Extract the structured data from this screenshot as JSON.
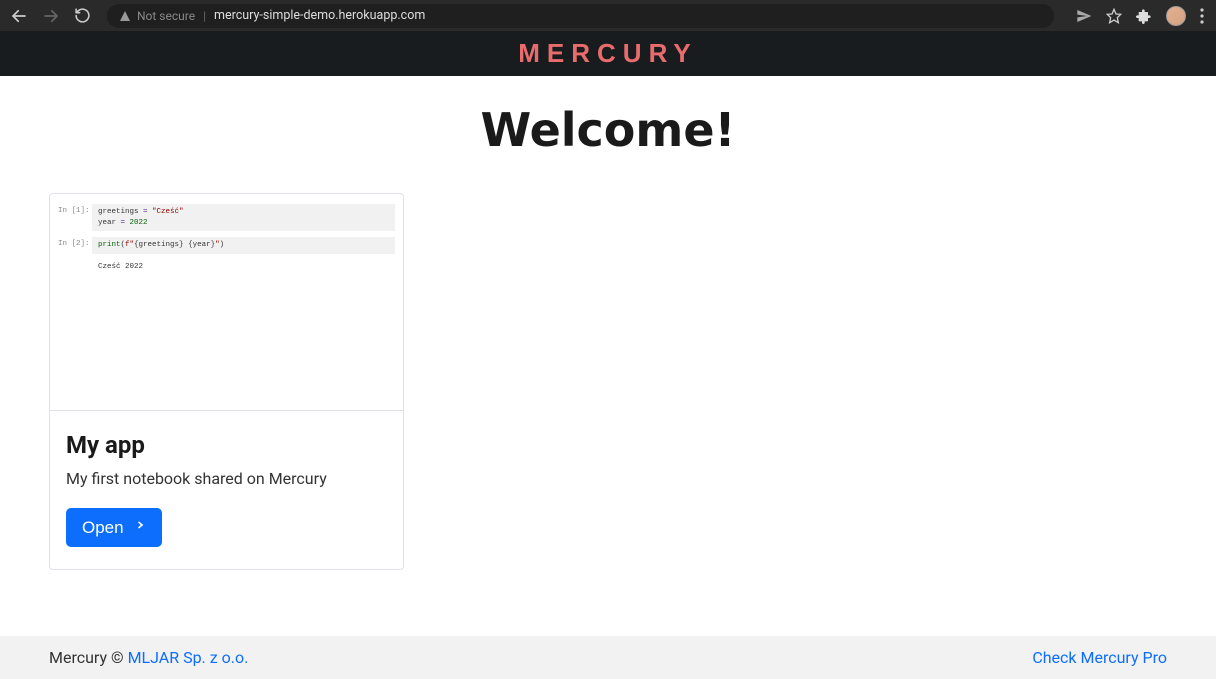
{
  "browser": {
    "not_secure_label": "Not secure",
    "url": "mercury-simple-demo.herokuapp.com"
  },
  "header": {
    "logo_text": "MERCURY"
  },
  "main": {
    "title": "Welcome!"
  },
  "card": {
    "title": "My app",
    "description": "My first notebook shared on Mercury",
    "open_label": "Open",
    "preview": {
      "cell1_prompt": "In [1]:",
      "cell1_line1_var": "greetings ",
      "cell1_line1_eq": "=",
      "cell1_line1_val": " \"Cześć\"",
      "cell1_line2_var": "year ",
      "cell1_line2_eq": "=",
      "cell1_line2_val": " 2022",
      "cell2_prompt": "In [2]:",
      "cell2_code_a": "print",
      "cell2_code_b": "(",
      "cell2_code_c": "f\"",
      "cell2_code_d": "{greetings}",
      "cell2_code_e": " ",
      "cell2_code_f": "{year}",
      "cell2_code_g": "\"",
      "cell2_code_h": ")",
      "cell2_output": "Cześć 2022"
    }
  },
  "footer": {
    "prefix": "Mercury © ",
    "company_link": "MLJAR Sp. z o.o.",
    "pro_link": "Check Mercury Pro"
  }
}
